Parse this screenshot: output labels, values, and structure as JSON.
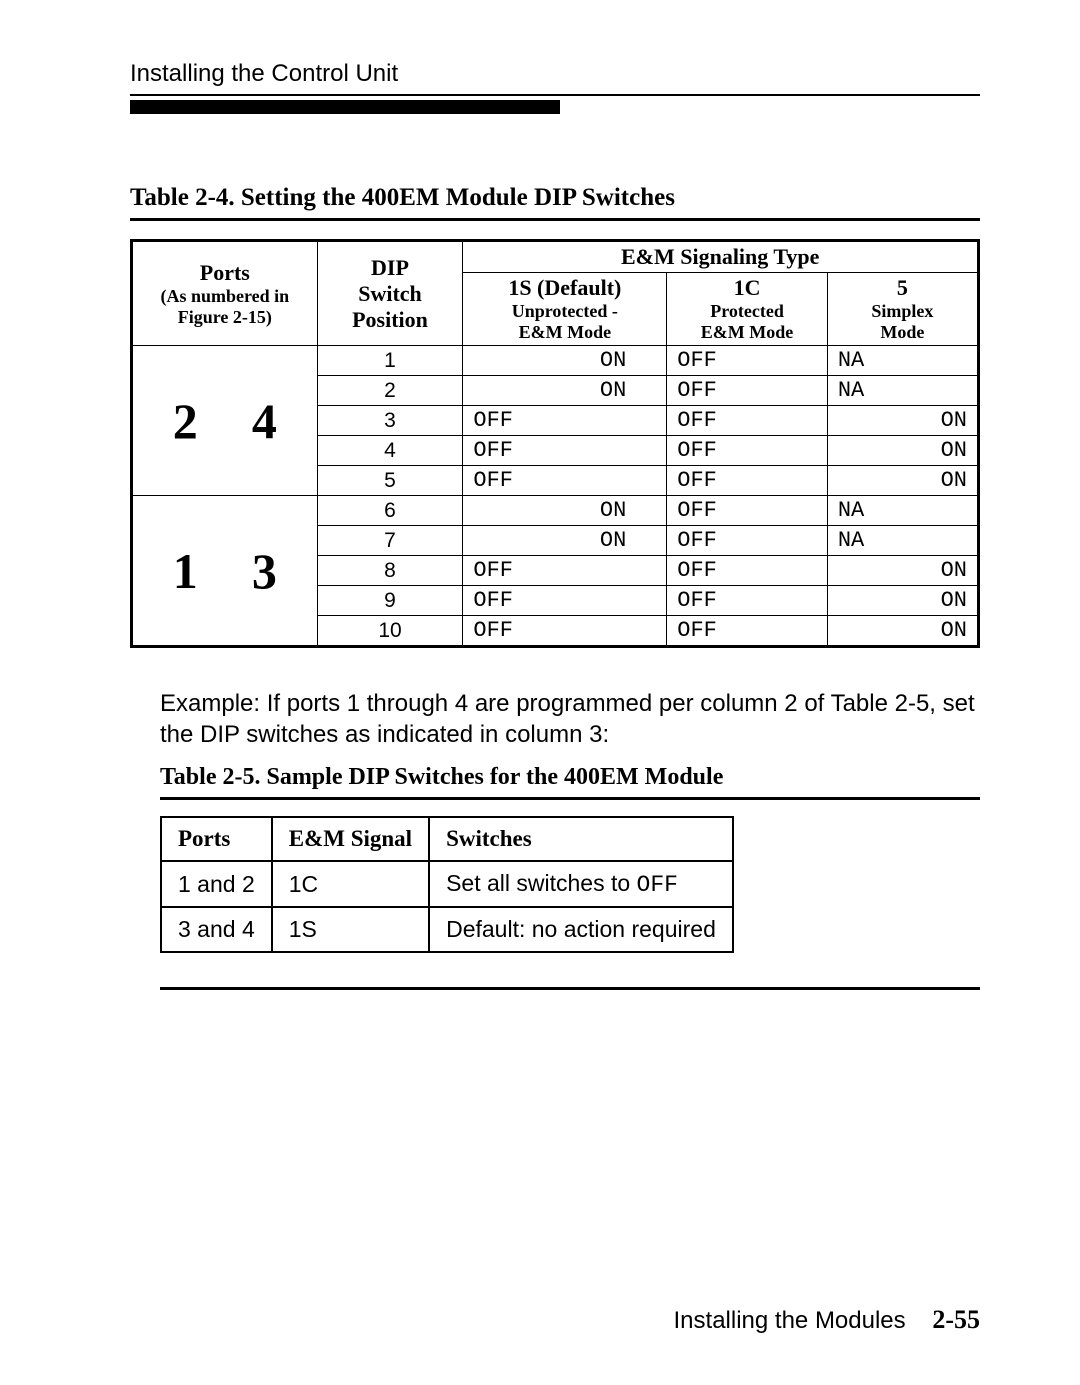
{
  "header": {
    "running": "Installing the Control Unit"
  },
  "table24": {
    "title": "Table 2-4.  Setting the 400EM Module DIP Switches",
    "col_ports_label": "Ports",
    "col_ports_sub1": "(As numbered in",
    "col_ports_sub2": "Figure 2-15)",
    "col_dip_l1": "DIP",
    "col_dip_l2": "Switch",
    "col_dip_l3": "Position",
    "sig_header": "E&M Signaling Type",
    "sig1_l1": "1S (Default)",
    "sig1_l2": "Unprotected -",
    "sig1_l3": "E&M Mode",
    "sig2_l1": "1C",
    "sig2_l2": "Protected",
    "sig2_l3": "E&M Mode",
    "sig3_l1": "5",
    "sig3_l2": "Simplex",
    "sig3_l3": "Mode",
    "groups": [
      {
        "port_left": "2",
        "port_right": "4",
        "rows": [
          {
            "sw": "1",
            "s1": "ON",
            "s2": "OFF",
            "s3": "NA"
          },
          {
            "sw": "2",
            "s1": "ON",
            "s2": "OFF",
            "s3": "NA"
          },
          {
            "sw": "3",
            "s1": "OFF",
            "s2": "OFF",
            "s3": "ON"
          },
          {
            "sw": "4",
            "s1": "OFF",
            "s2": "OFF",
            "s3": "ON"
          },
          {
            "sw": "5",
            "s1": "OFF",
            "s2": "OFF",
            "s3": "ON"
          }
        ]
      },
      {
        "port_left": "1",
        "port_right": "3",
        "rows": [
          {
            "sw": "6",
            "s1": "ON",
            "s2": "OFF",
            "s3": "NA"
          },
          {
            "sw": "7",
            "s1": "ON",
            "s2": "OFF",
            "s3": "NA"
          },
          {
            "sw": "8",
            "s1": "OFF",
            "s2": "OFF",
            "s3": "ON"
          },
          {
            "sw": "9",
            "s1": "OFF",
            "s2": "OFF",
            "s3": "ON"
          },
          {
            "sw": "10",
            "s1": "OFF",
            "s2": "OFF",
            "s3": "ON"
          }
        ]
      }
    ]
  },
  "example": {
    "text1": "Example: If ports 1 through 4 are programmed per column 2 of Table 2-5, set the DIP switches as indicated in column 3:"
  },
  "table25": {
    "title": "Table 2-5. Sample DIP Switches for the 400EM Module",
    "h1": "Ports",
    "h2": "E&M Signal",
    "h3": "Switches",
    "r1c1": "1 and 2",
    "r1c2": "1C",
    "r1c3_pre": "Set all switches to ",
    "r1c3_code": "OFF",
    "r2c1": "3 and 4",
    "r2c2": "1S",
    "r2c3": "Default: no action required"
  },
  "footer": {
    "label": "Installing the Modules",
    "page": "2-55"
  }
}
